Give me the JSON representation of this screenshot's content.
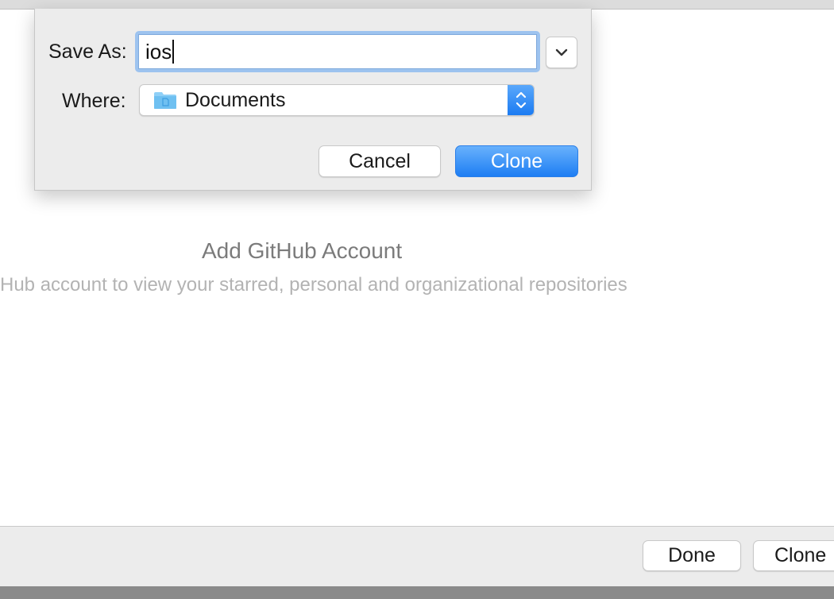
{
  "background_panel": {
    "title": "Add GitHub Account",
    "subtitle": "Hub account to view your starred, personal and organizational repositories"
  },
  "footer": {
    "done_label": "Done",
    "clone_label": "Clone"
  },
  "save_sheet": {
    "save_as_label": "Save As:",
    "save_as_value": "ios",
    "where_label": "Where:",
    "where_value": "Documents",
    "cancel_label": "Cancel",
    "clone_label": "Clone",
    "icons": {
      "expand": "chevron-down-icon",
      "folder": "folder-icon",
      "stepper": "up-down-stepper-icon"
    }
  },
  "colors": {
    "accent": "#1e7ef3",
    "focus_ring": "#9dc3ef",
    "folder": "#7cc5f2"
  }
}
